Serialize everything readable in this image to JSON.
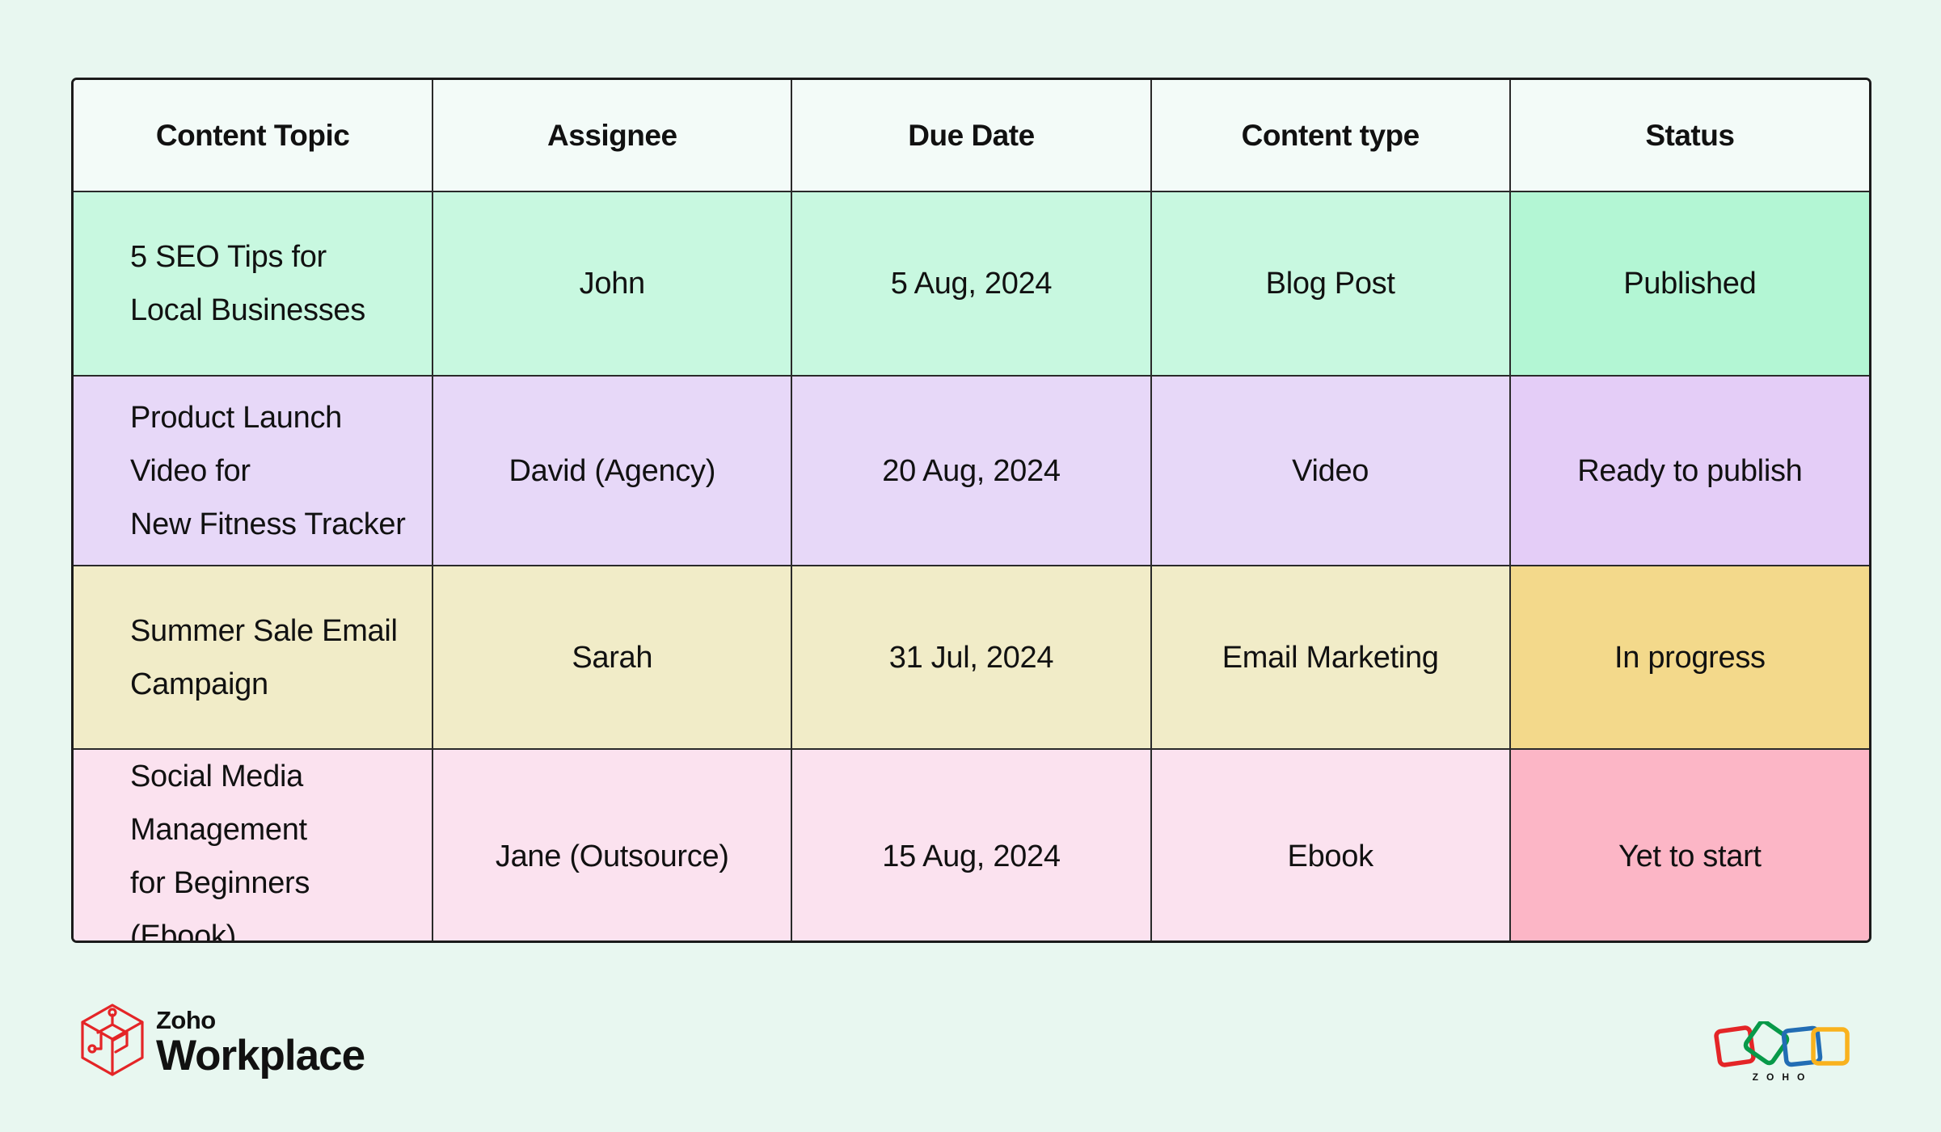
{
  "table": {
    "headers": [
      "Content Topic",
      "Assignee",
      "Due Date",
      "Content type",
      "Status"
    ],
    "rows": [
      {
        "topic_lines": [
          "5 SEO Tips for",
          "Local Businesses"
        ],
        "assignee": "John",
        "due_date": "5 Aug, 2024",
        "content_type": "Blog Post",
        "status": "Published",
        "row_color": "#c8f8e0",
        "status_color": "#b3f6d4"
      },
      {
        "topic_lines": [
          "Product Launch Video for",
          "New Fitness Tracker"
        ],
        "assignee": "David (Agency)",
        "due_date": "20 Aug, 2024",
        "content_type": "Video",
        "status": "Ready to publish",
        "row_color": "#e7d8f8",
        "status_color": "#e4cdf7"
      },
      {
        "topic_lines": [
          "Summer Sale Email",
          "Campaign"
        ],
        "assignee": "Sarah",
        "due_date": "31 Jul, 2024",
        "content_type": "Email Marketing",
        "status": "In progress",
        "row_color": "#f1ecc8",
        "status_color": "#f3d98b"
      },
      {
        "topic_lines": [
          "Social Media Management",
          "for Beginners (Ebook)"
        ],
        "assignee": "Jane (Outsource)",
        "due_date": "15 Aug, 2024",
        "content_type": "Ebook",
        "status": "Yet to start",
        "row_color": "#fbe2ef",
        "status_color": "#fcb6c6"
      }
    ]
  },
  "branding": {
    "left_logo_icon": "workplace-cube-icon",
    "left_small": "Zoho",
    "left_big": "Workplace",
    "right_logo_icon": "zoho-rings-icon",
    "right_word": "ZOHO",
    "colors": {
      "workplace_red": "#e42527",
      "zoho_red": "#e42527",
      "zoho_green": "#089949",
      "zoho_blue": "#226db4",
      "zoho_yellow": "#f9b21d"
    }
  }
}
